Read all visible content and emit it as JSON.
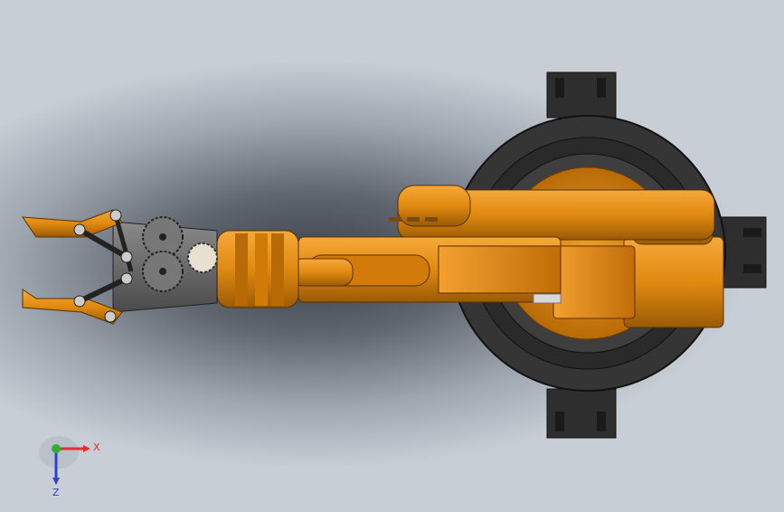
{
  "viewport": {
    "colors": {
      "background_dark": "#3c4148",
      "background_light": "#c7ced6",
      "arm_orange": "#e08a10",
      "arm_orange_dark": "#9a5a05",
      "arm_orange_light": "#f6a93a",
      "base_dark": "#3a3a3a",
      "gripper_gray": "#6b6b6b"
    }
  },
  "triad": {
    "x_label": "X",
    "z_label": "Z",
    "x_color": "#e03030",
    "y_color": "#30b030",
    "z_color": "#3040d0"
  }
}
